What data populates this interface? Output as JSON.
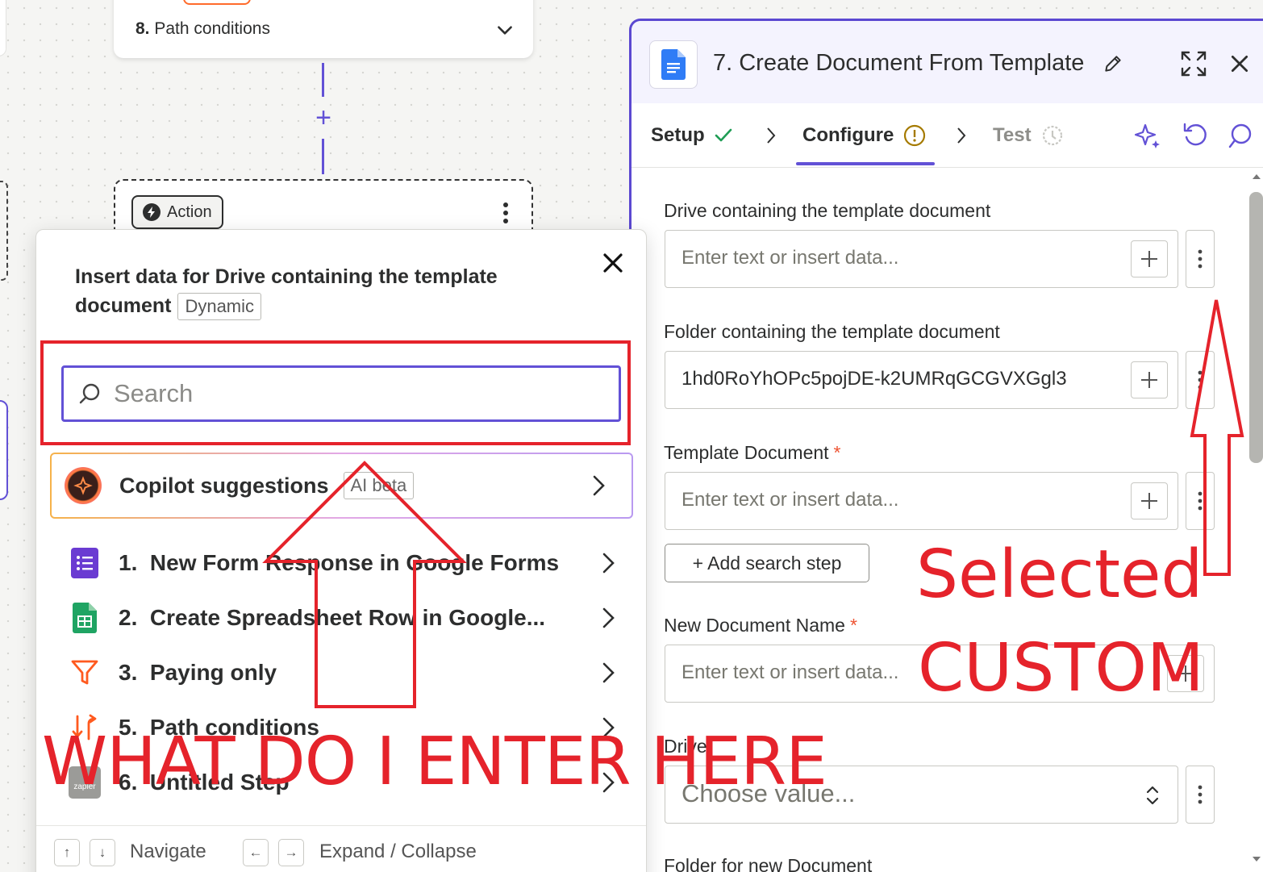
{
  "canvas": {
    "upper_step": {
      "number": "8.",
      "label": "Path conditions"
    },
    "action_card": {
      "badge": "Action"
    }
  },
  "popup": {
    "title": "Insert data for Drive containing the template document",
    "badge": "Dynamic",
    "search_placeholder": "Search",
    "copilot": {
      "label": "Copilot suggestions",
      "badge": "AI beta"
    },
    "items": [
      {
        "number": "1.",
        "label": "New Form Response in Google Forms",
        "icon": "google-forms-icon"
      },
      {
        "number": "2.",
        "label": "Create Spreadsheet Row in Google...",
        "icon": "google-sheets-icon"
      },
      {
        "number": "3.",
        "label": "Paying only",
        "icon": "filter-icon"
      },
      {
        "number": "5.",
        "label": "Path conditions",
        "icon": "paths-icon"
      },
      {
        "number": "6.",
        "label": "Untitled Step",
        "icon": "zapier-icon"
      }
    ],
    "footer": {
      "navigate_label": "Navigate",
      "expand_label": "Expand / Collapse",
      "keys": [
        "↑",
        "↓",
        "←",
        "→"
      ]
    }
  },
  "panel": {
    "title": "7. Create Document From Template",
    "tabs": [
      {
        "label": "Setup",
        "status": "complete"
      },
      {
        "label": "Configure",
        "status": "warning"
      },
      {
        "label": "Test",
        "status": "pending"
      }
    ],
    "fields": {
      "drive_template": {
        "label": "Drive containing the template document",
        "placeholder": "Enter text or insert data..."
      },
      "folder_template": {
        "label": "Folder containing the template document",
        "value": "1hd0RoYhOPc5pojDE-k2UMRqGCGVXGgl3"
      },
      "template_document": {
        "label": "Template Document",
        "required": "*",
        "placeholder": "Enter text or insert data..."
      },
      "add_search_step": "+ Add search step",
      "new_document_name": {
        "label": "New Document Name",
        "required": "*",
        "placeholder": "Enter text or insert data..."
      },
      "drive": {
        "label": "Drive",
        "placeholder": "Choose value..."
      },
      "folder_new": {
        "label": "Folder for new Document"
      }
    }
  },
  "annotations": {
    "selected": "Selected",
    "custom": "CUSTOM",
    "question": "WHAT DO I ENTER HERE",
    "color": "#e5232b"
  },
  "colors": {
    "accent": "#6251d6",
    "annotation": "#e5232b",
    "required": "#ee5433"
  }
}
